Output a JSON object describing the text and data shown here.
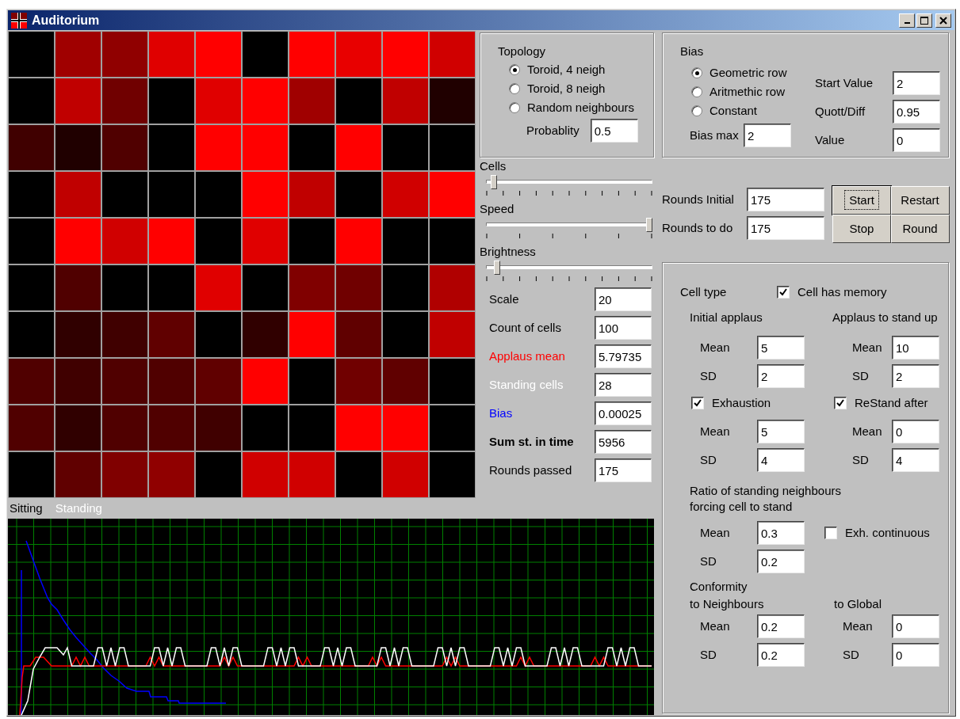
{
  "window": {
    "title": "Auditorium"
  },
  "audience_grid": {
    "rows": [
      {
        "cells": [
          {
            "color": "#000000"
          },
          {
            "color": "#a00000"
          },
          {
            "color": "#900000"
          },
          {
            "color": "#e00000"
          },
          {
            "color": "#ff0000"
          },
          {
            "color": "#000000"
          },
          {
            "color": "#ff0000"
          },
          {
            "color": "#e80000"
          },
          {
            "color": "#ff0000"
          },
          {
            "color": "#d00000"
          }
        ]
      },
      {
        "cells": [
          {
            "color": "#000000"
          },
          {
            "color": "#c00000"
          },
          {
            "color": "#700000"
          },
          {
            "color": "#000000"
          },
          {
            "color": "#e00000"
          },
          {
            "color": "#ff0000"
          },
          {
            "color": "#a00000"
          },
          {
            "color": "#000000"
          },
          {
            "color": "#c00000"
          },
          {
            "color": "#200000"
          }
        ]
      },
      {
        "cells": [
          {
            "color": "#400000"
          },
          {
            "color": "#200000"
          },
          {
            "color": "#500000"
          },
          {
            "color": "#000000"
          },
          {
            "color": "#ff0000"
          },
          {
            "color": "#ff0000"
          },
          {
            "color": "#000000"
          },
          {
            "color": "#ff0000"
          },
          {
            "color": "#000000"
          },
          {
            "color": "#000000"
          }
        ]
      },
      {
        "cells": [
          {
            "color": "#000000"
          },
          {
            "color": "#c00000"
          },
          {
            "color": "#000000"
          },
          {
            "color": "#000000"
          },
          {
            "color": "#000000"
          },
          {
            "color": "#ff0000"
          },
          {
            "color": "#c00000"
          },
          {
            "color": "#000000"
          },
          {
            "color": "#d00000"
          },
          {
            "color": "#ff0000"
          }
        ]
      },
      {
        "cells": [
          {
            "color": "#000000"
          },
          {
            "color": "#ff0000"
          },
          {
            "color": "#d00000"
          },
          {
            "color": "#ff0000"
          },
          {
            "color": "#000000"
          },
          {
            "color": "#e00000"
          },
          {
            "color": "#000000"
          },
          {
            "color": "#ff0000"
          },
          {
            "color": "#000000"
          },
          {
            "color": "#000000"
          }
        ]
      },
      {
        "cells": [
          {
            "color": "#000000"
          },
          {
            "color": "#500000"
          },
          {
            "color": "#000000"
          },
          {
            "color": "#000000"
          },
          {
            "color": "#e00000"
          },
          {
            "color": "#000000"
          },
          {
            "color": "#800000"
          },
          {
            "color": "#700000"
          },
          {
            "color": "#000000"
          },
          {
            "color": "#b00000"
          }
        ]
      },
      {
        "cells": [
          {
            "color": "#000000"
          },
          {
            "color": "#300000"
          },
          {
            "color": "#400000"
          },
          {
            "color": "#600000"
          },
          {
            "color": "#000000"
          },
          {
            "color": "#300000"
          },
          {
            "color": "#ff0000"
          },
          {
            "color": "#600000"
          },
          {
            "color": "#000000"
          },
          {
            "color": "#c00000"
          }
        ]
      },
      {
        "cells": [
          {
            "color": "#500000"
          },
          {
            "color": "#400000"
          },
          {
            "color": "#500000"
          },
          {
            "color": "#500000"
          },
          {
            "color": "#600000"
          },
          {
            "color": "#ff0000"
          },
          {
            "color": "#000000"
          },
          {
            "color": "#700000"
          },
          {
            "color": "#600000"
          },
          {
            "color": "#000000"
          }
        ]
      },
      {
        "cells": [
          {
            "color": "#500000"
          },
          {
            "color": "#300000"
          },
          {
            "color": "#500000"
          },
          {
            "color": "#500000"
          },
          {
            "color": "#400000"
          },
          {
            "color": "#000000"
          },
          {
            "color": "#000000"
          },
          {
            "color": "#ff0000"
          },
          {
            "color": "#ff0000"
          },
          {
            "color": "#000000"
          }
        ]
      },
      {
        "cells": [
          {
            "color": "#000000"
          },
          {
            "color": "#600000"
          },
          {
            "color": "#800000"
          },
          {
            "color": "#900000"
          },
          {
            "color": "#000000"
          },
          {
            "color": "#d00000"
          },
          {
            "color": "#d00000"
          },
          {
            "color": "#000000"
          },
          {
            "color": "#d00000"
          },
          {
            "color": "#000000"
          }
        ]
      }
    ]
  },
  "legend": [
    {
      "label": "Sitting",
      "color": "#000000"
    },
    {
      "label": "Standing",
      "color": "#ffffff"
    }
  ],
  "topology": {
    "title": "Topology",
    "options": [
      {
        "label": "Toroid, 4 neigh",
        "selected": true
      },
      {
        "label": "Toroid, 8 neigh",
        "selected": false
      },
      {
        "label": "Random neighbours",
        "selected": false
      }
    ],
    "probability": {
      "label": "Probablity",
      "value": "0.5"
    }
  },
  "sliders": [
    {
      "label": "Cells",
      "level": 0.03,
      "kind": "fine"
    },
    {
      "label": "Speed",
      "level": 1.0,
      "kind": "coarse"
    },
    {
      "label": "Brightness",
      "level": 0.05,
      "kind": "fine"
    }
  ],
  "stats": [
    {
      "label": "Scale",
      "value": "20",
      "color": "#000000",
      "bold": false
    },
    {
      "label": "Count of cells",
      "value": "100",
      "color": "#000000",
      "bold": false
    },
    {
      "label": "Applaus mean",
      "value": "5.79735",
      "color": "#ff0000",
      "bold": false
    },
    {
      "label": "Standing cells",
      "value": "28",
      "color": "#ffffff",
      "bold": false
    },
    {
      "label": "Bias",
      "value": "0.00025",
      "color": "#0000ff",
      "bold": false
    },
    {
      "label": "Sum st. in time",
      "value": "5956",
      "color": "#000000",
      "bold": true
    },
    {
      "label": "Rounds passed",
      "value": "175",
      "color": "#000000",
      "bold": false
    }
  ],
  "bias": {
    "title": "Bias",
    "options": [
      {
        "label": "Geometric row",
        "selected": true
      },
      {
        "label": "Aritmethic row",
        "selected": false
      },
      {
        "label": "Constant",
        "selected": false
      }
    ],
    "bias_max": {
      "label": "Bias max",
      "value": "2"
    },
    "fields": [
      {
        "label": "Start Value",
        "value": "2"
      },
      {
        "label": "Quott/Diff",
        "value": "0.95"
      },
      {
        "label": "Value",
        "value": "0"
      }
    ]
  },
  "rounds": [
    {
      "label": "Rounds Initial",
      "value": "175"
    },
    {
      "label": "Rounds to do",
      "value": "175"
    }
  ],
  "buttons": [
    {
      "label": "Start",
      "focused": true
    },
    {
      "label": "Restart",
      "focused": false
    },
    {
      "label": "Stop",
      "focused": false
    },
    {
      "label": "Round",
      "focused": false
    }
  ],
  "cell_panel": {
    "cell_type": "Cell type",
    "memory": {
      "label": "Cell has memory",
      "checked": true
    },
    "initial_applaus": {
      "title": "Initial applaus",
      "fields": [
        {
          "label": "Mean",
          "value": "5"
        },
        {
          "label": "SD",
          "value": "2"
        }
      ]
    },
    "stand_up": {
      "title": "Applaus to stand up",
      "fields": [
        {
          "label": "Mean",
          "value": "10"
        },
        {
          "label": "SD",
          "value": "2"
        }
      ]
    },
    "exhaustion": {
      "label": "Exhaustion",
      "checked": true,
      "fields": [
        {
          "label": "Mean",
          "value": "5"
        },
        {
          "label": "SD",
          "value": "4"
        }
      ]
    },
    "restand": {
      "label": "ReStand after",
      "checked": true,
      "fields": [
        {
          "label": "Mean",
          "value": "0"
        },
        {
          "label": "SD",
          "value": "4"
        }
      ]
    },
    "ratio": {
      "title": "Ratio of standing neighbours\nforcing cell to stand",
      "fields": [
        {
          "label": "Mean",
          "value": "0.3"
        },
        {
          "label": "SD",
          "value": "0.2"
        }
      ]
    },
    "exh_continuous": {
      "label": "Exh. continuous",
      "checked": false
    },
    "conformity": {
      "title": "Conformity",
      "neighbours": {
        "title": "to Neighbours",
        "fields": [
          {
            "label": "Mean",
            "value": "0.2"
          },
          {
            "label": "SD",
            "value": "0.2"
          }
        ]
      },
      "global": {
        "title": "to Global",
        "fields": [
          {
            "label": "Mean",
            "value": "0"
          },
          {
            "label": "SD",
            "value": "0"
          }
        ]
      }
    }
  }
}
